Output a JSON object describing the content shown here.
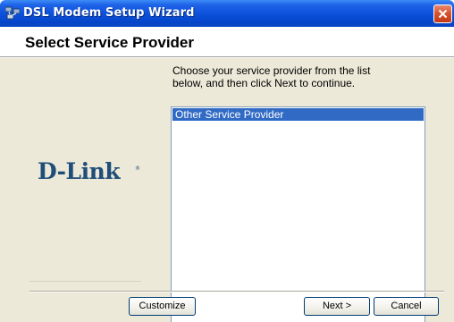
{
  "window": {
    "title": "DSL Modem Setup Wizard"
  },
  "header": {
    "title": "Select Service Provider"
  },
  "main": {
    "instruction_line1": "Choose your service provider from the list",
    "instruction_line2": "below, and then click Next to continue.",
    "providers": [
      "Other Service Provider"
    ],
    "selected_provider": "Other Service Provider",
    "logo_text": "D-Link",
    "logo_mark": "®"
  },
  "footer": {
    "customize_label": "Customize",
    "next_label": "Next >",
    "cancel_label": "Cancel"
  },
  "colors": {
    "titlebar_blue": "#0a4fd9",
    "selection_blue": "#316ac5",
    "dialog_bg": "#ece9d8",
    "logo_blue": "#1f4e79",
    "close_red": "#d6502c"
  },
  "icons": {
    "app_icon": "network-computers-icon",
    "close_icon": "close-icon"
  }
}
